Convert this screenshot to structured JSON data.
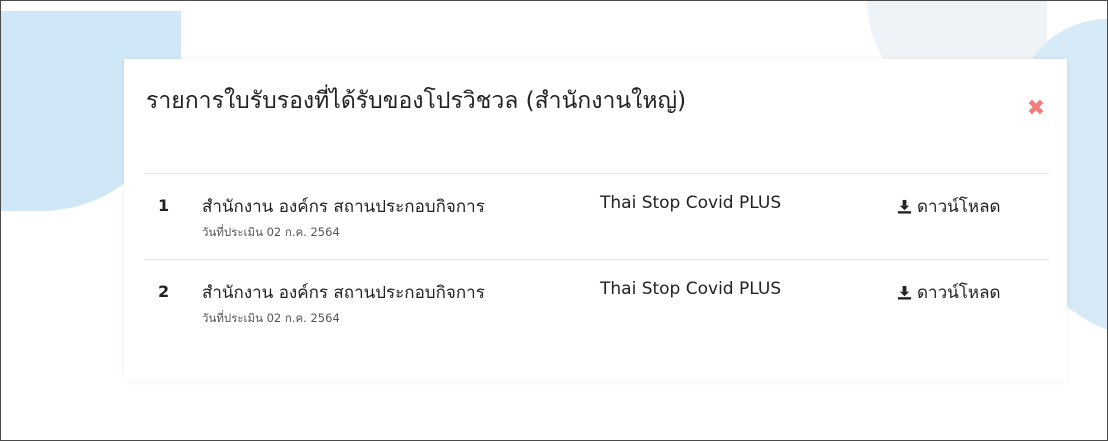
{
  "modal": {
    "title": "รายการใบรับรองที่ได้รับของโปรวิชวล (สำนักงานใหญ่)",
    "close_icon": "close-x-icon",
    "accent_close_color": "#f07c7c"
  },
  "certificates": [
    {
      "number": "1",
      "organization": "สำนักงาน องค์กร สถานประกอบกิจการ",
      "assessment_date": "วันที่ประเมิน 02 ก.ค. 2564",
      "program": "Thai Stop Covid PLUS",
      "download_label": "ดาวน์โหลด",
      "download_icon": "download-icon"
    },
    {
      "number": "2",
      "organization": "สำนักงาน องค์กร สถานประกอบกิจการ",
      "assessment_date": "วันที่ประเมิน 02 ก.ค. 2564",
      "program": "Thai Stop Covid PLUS",
      "download_label": "ดาวน์โหลด",
      "download_icon": "download-icon"
    }
  ]
}
